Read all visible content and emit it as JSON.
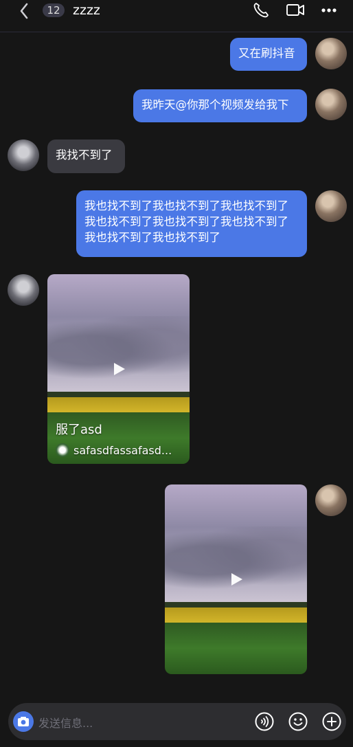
{
  "header": {
    "unread_count": "12",
    "title": "zzzz"
  },
  "messages": [
    {
      "side": "me",
      "text": "又在刷抖音"
    },
    {
      "side": "me",
      "text": "我昨天@你那个视频发给我下"
    },
    {
      "side": "other",
      "text": "我找不到了"
    },
    {
      "side": "me",
      "text": "我也找不到了我也找不到了我也找不到了我也找不到了我也找不到了我也找不到了我也找不到了我也找不到了"
    }
  ],
  "videos": [
    {
      "side": "other",
      "caption": "服了asd",
      "author": "safasdfassafasd..."
    },
    {
      "side": "me",
      "caption": "",
      "author": ""
    }
  ],
  "input": {
    "placeholder": "发送信息..."
  },
  "colors": {
    "background": "#161616",
    "my_bubble": "#4b78e6",
    "other_bubble": "#3a3a40",
    "input_bar": "#2d2d30"
  },
  "icons": [
    "back-arrow-icon",
    "phone-icon",
    "video-call-icon",
    "more-icon",
    "camera-icon",
    "voice-icon",
    "emoji-icon",
    "plus-icon"
  ]
}
